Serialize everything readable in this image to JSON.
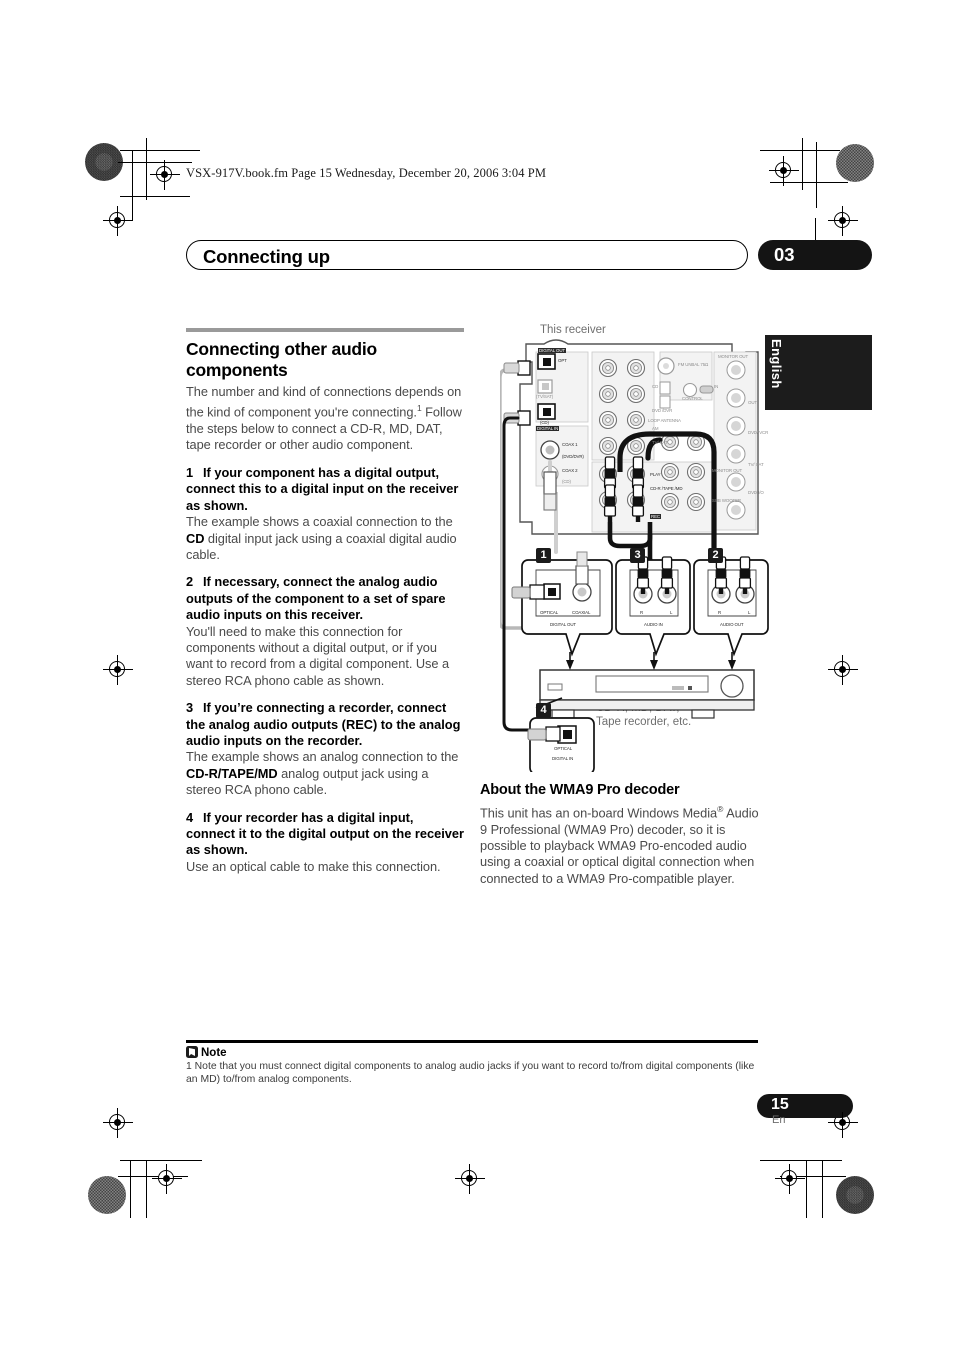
{
  "header": {
    "file_line": "VSX-917V.book.fm  Page 15  Wednesday, December 20, 2006  3:04 PM"
  },
  "chapter": {
    "title": "Connecting up",
    "number": "03"
  },
  "side_tab": {
    "language": "English"
  },
  "left_column": {
    "section_title": "Connecting other audio components",
    "intro_1": "The number and kind of connections depends on the kind of component you're connecting.",
    "intro_footnote_marker": "1",
    "intro_2": "Follow the steps below to connect a CD-R, MD, DAT, tape recorder or other audio component.",
    "steps": [
      {
        "num": "1",
        "title": "If your component has a digital output, connect this to a digital input on the receiver as shown.",
        "body_pre": "The example shows a coaxial connection to the ",
        "body_bold": "CD",
        "body_post": " digital input jack using a coaxial digital audio cable."
      },
      {
        "num": "2",
        "title": "If necessary, connect the analog audio outputs of the component to a set of spare audio inputs on this receiver.",
        "body_pre": "You'll need to make this connection for components without a digital output, or if you want to record from a digital component. Use a stereo RCA phono cable as shown.",
        "body_bold": "",
        "body_post": ""
      },
      {
        "num": "3",
        "title": "If you’re connecting a recorder, connect the analog audio outputs (REC) to the analog audio inputs on the recorder.",
        "body_pre": "The example shows an analog connection to the ",
        "body_bold": "CD-R/TAPE/MD",
        "body_post": " analog output jack using a stereo RCA phono cable."
      },
      {
        "num": "4",
        "title": "If your recorder has a digital input, connect it to the digital output on the receiver as shown.",
        "body_pre": "Use an optical cable to make this connection.",
        "body_bold": "",
        "body_post": ""
      }
    ]
  },
  "right_column": {
    "section_title": "About the WMA9 Pro decoder",
    "body_pre": "This unit has an on-board Windows Media",
    "body_sup": "®",
    "body_post": " Audio 9 Professional (WMA9 Pro) decoder, so it is possible to playback WMA9 Pro-encoded audio using a coaxial or optical digital connection when connected to a WMA9 Pro-compatible player."
  },
  "figure": {
    "caption_receiver": "This receiver",
    "caption_device_line1": "CD-R, MD, DAT,",
    "caption_device_line2": "Tape recorder, etc.",
    "callouts": [
      {
        "num": "1",
        "group": "DIGITAL OUT",
        "jacks": [
          "OPTICAL",
          "COAXIAL"
        ]
      },
      {
        "num": "3",
        "group": "AUDIO IN",
        "jacks": [
          "R",
          "L"
        ]
      },
      {
        "num": "2",
        "group": "AUDIO OUT",
        "jacks": [
          "R",
          "L"
        ]
      },
      {
        "num": "4",
        "group": "DIGITAL IN",
        "jacks": [
          "OPTICAL"
        ]
      }
    ],
    "panel_labels": [
      "DIGITAL OUT",
      "OPT",
      "(TV/SAT)",
      "(CD)",
      "DIGITAL IN",
      "COAX 1",
      "(DVD/DVR)",
      "COAX 2",
      "(CD)",
      "FM UNBAL 75Ω",
      "CONTROL",
      "LOOP ANTENNA",
      "AM",
      "MONITOR OUT",
      "IN",
      "OUT",
      "PLAY",
      "REC",
      "CD-R /TAPE /MD",
      "TV/ SAT",
      "DVD /DVR",
      "CD",
      "SUB WOOFER",
      "MONITOR OUT",
      "DVD/ VCR",
      "TV/ SAT",
      "DVD I/O"
    ]
  },
  "note": {
    "heading": "Note",
    "text": "1 Note that you must connect digital components to analog audio jacks if you want to record to/from digital components (like an MD) to/from analog components."
  },
  "page_footer": {
    "number": "15",
    "language": "En"
  },
  "colors": {
    "ink": "#000000",
    "body_gray": "#4a4a4a",
    "rule_gray": "#9a9a9a",
    "badge_black": "#141414"
  }
}
